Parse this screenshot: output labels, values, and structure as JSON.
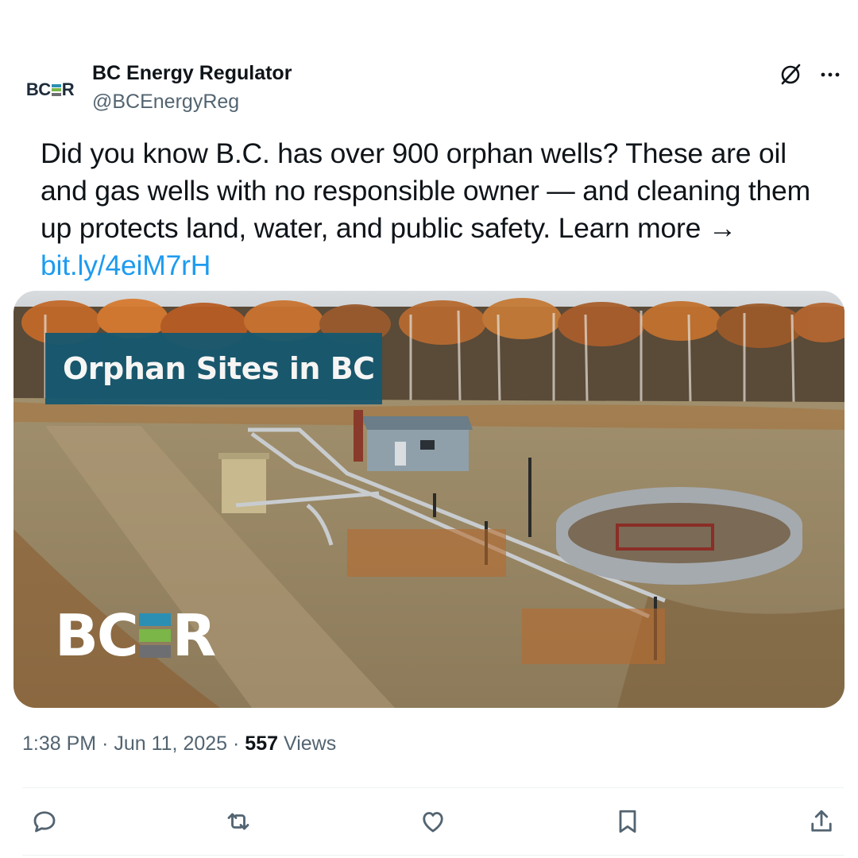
{
  "author": {
    "name": "BC Energy Regulator",
    "handle": "@BCEnergyReg",
    "avatar_logo": "BCER"
  },
  "tweet": {
    "text": "Did you know B.C. has over 900 orphan wells? These are oil and gas wells with no responsible owner — and cleaning them up protects land, water, and public safety. Learn more → ",
    "link": "bit.ly/4eiM7rH"
  },
  "media": {
    "banner_text": "Orphan Sites in BC",
    "watermark": "BCER",
    "banner_color": "#165870"
  },
  "meta": {
    "time": "1:38 PM",
    "date": "Jun 11, 2025",
    "views_count": "557",
    "views_label": "Views"
  },
  "icons": {
    "header": [
      "grok-icon",
      "more-icon"
    ],
    "actions": [
      "reply-icon",
      "retweet-icon",
      "like-icon",
      "bookmark-icon",
      "share-icon"
    ]
  },
  "colors": {
    "text": "#0f1419",
    "secondary": "#536471",
    "link": "#1d9bf0"
  }
}
